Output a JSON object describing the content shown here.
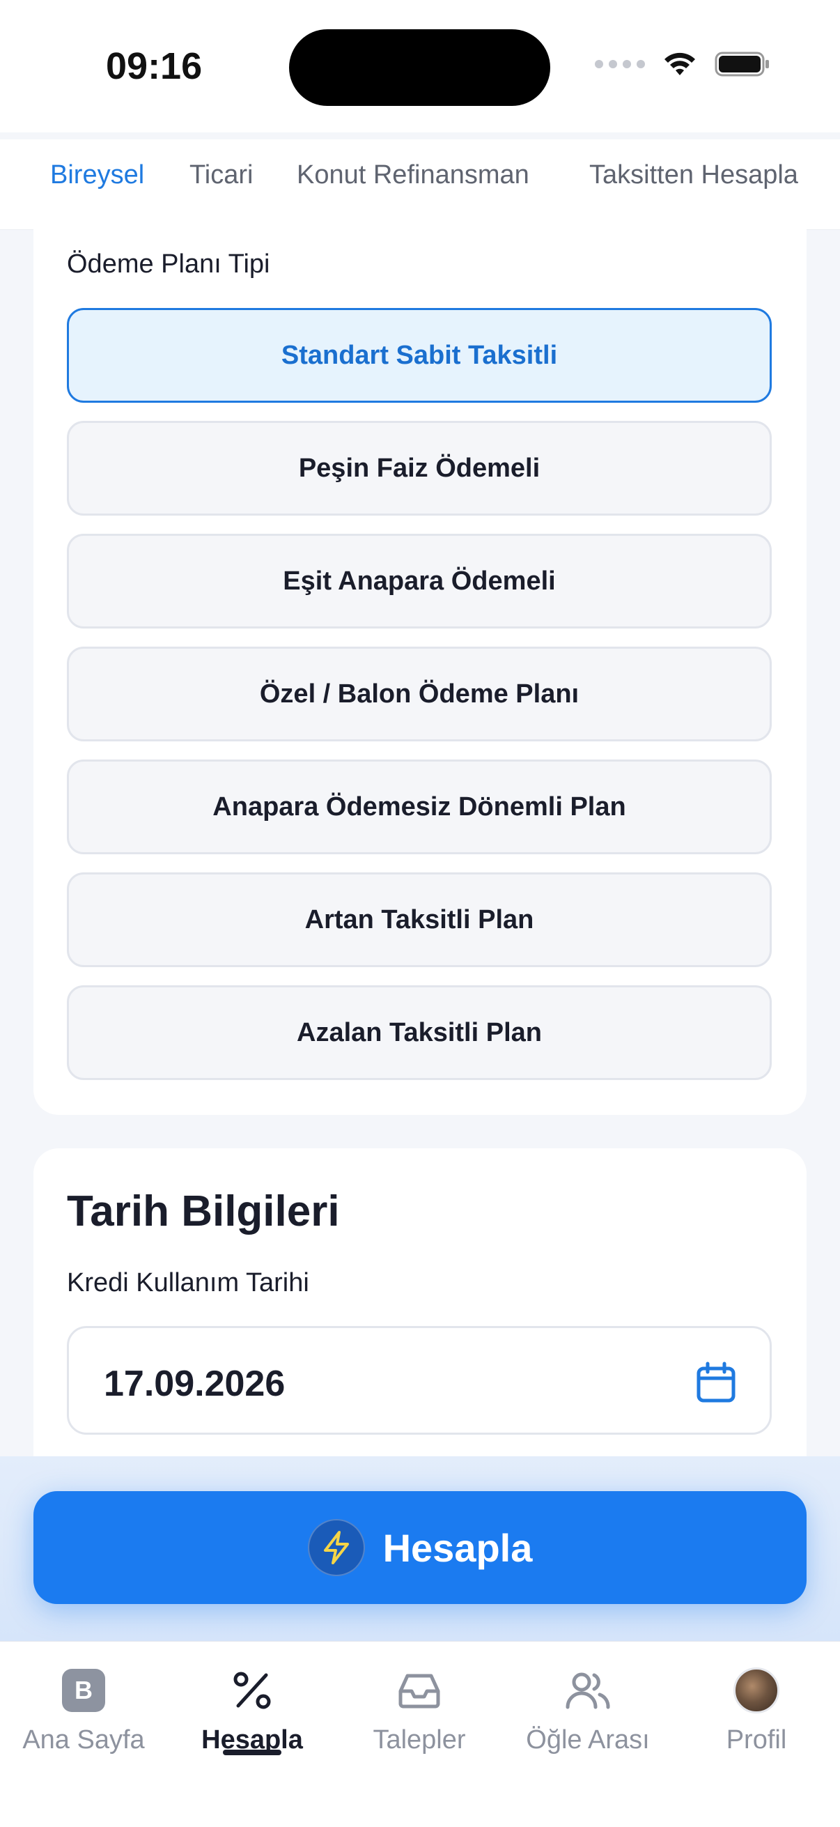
{
  "status_bar": {
    "time": "09:16"
  },
  "tabs": [
    {
      "label": "Bireysel",
      "active": true
    },
    {
      "label": "Ticari",
      "active": false
    },
    {
      "label": "Konut Refinansman",
      "active": false
    },
    {
      "label": "Taksitten Hesapla",
      "active": false
    }
  ],
  "payment_plan": {
    "label": "Ödeme Planı Tipi",
    "options": [
      {
        "label": "Standart Sabit Taksitli",
        "selected": true
      },
      {
        "label": "Peşin Faiz Ödemeli",
        "selected": false
      },
      {
        "label": "Eşit Anapara Ödemeli",
        "selected": false
      },
      {
        "label": "Özel / Balon Ödeme Planı",
        "selected": false
      },
      {
        "label": "Anapara Ödemesiz Dönemli Plan",
        "selected": false
      },
      {
        "label": "Artan Taksitli Plan",
        "selected": false
      },
      {
        "label": "Azalan Taksitli Plan",
        "selected": false
      }
    ]
  },
  "date_info": {
    "title": "Tarih Bilgileri",
    "field_label": "Kredi Kullanım Tarihi",
    "value": "17.09.2026",
    "icon": "calendar-icon"
  },
  "action": {
    "label": "Hesapla",
    "icon": "bolt-icon"
  },
  "bottom_nav": [
    {
      "label": "Ana Sayfa",
      "icon": "home-app-icon",
      "active": false
    },
    {
      "label": "Hesapla",
      "icon": "percent-icon",
      "active": true
    },
    {
      "label": "Talepler",
      "icon": "inbox-icon",
      "active": false
    },
    {
      "label": "Öğle Arası",
      "icon": "users-icon",
      "active": false
    },
    {
      "label": "Profil",
      "icon": "avatar",
      "active": false
    }
  ],
  "colors": {
    "accent": "#1b7bf0",
    "selected_bg": "#e6f3fd",
    "text": "#1a1d2b",
    "muted": "#8d929e"
  }
}
